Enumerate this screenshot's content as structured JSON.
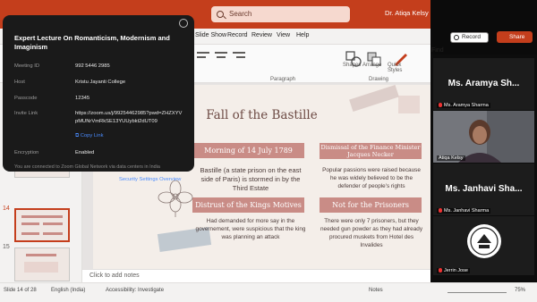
{
  "titlebar": {
    "search_placeholder": "Search",
    "user_name": "Dr. Atiqa Kelsy"
  },
  "menu": [
    "Slide Show",
    "Record",
    "Review",
    "View",
    "Help"
  ],
  "record_label": "Record",
  "share_label": "Share",
  "ribbon": {
    "find_label": "Find",
    "paragraph_label": "Paragraph",
    "drawing_label": "Drawing",
    "shapes_label": "Shapes",
    "arrange_label": "Arrange",
    "quick_styles_label": "Quick Styles"
  },
  "thumbnails": [
    {
      "number": "14",
      "selected": true
    },
    {
      "number": "15",
      "selected": false
    }
  ],
  "slide": {
    "title": "Fall of the Bastille",
    "box1_head": "Morning of 14 July 1789",
    "box1_text": "Bastille (a state prison on the east side of Paris) is stormed in by the Third Estate",
    "box2_head": "Dismissal of the Finance Minister Jacques Necker",
    "box2_text": "Popular passions were raised because he was widely believed to be the defender of people's rights",
    "box3_head": "Distrust of the Kings Motives",
    "box3_text": "Had demanded for more say in the governement, were suspicious that the king was planning an attack",
    "box4_head": "Not for the Prisoners",
    "box4_text": "There were only 7 prisoners, but they needed gun powder as they had already procured muskets from Hotel des Invalides"
  },
  "notes_placeholder": "Click to add notes",
  "status": {
    "slide_count": "Slide 14 of 28",
    "language": "English (India)",
    "accessibility": "Accessibility: Investigate",
    "notes": "Notes",
    "zoom": "75%"
  },
  "zoom_info": {
    "title": "Expert Lecture On Romanticism, Modernism and Imaginism",
    "meeting_id_label": "Meeting ID",
    "meeting_id": "992 5446 2985",
    "host_label": "Host",
    "host": "Kristu Jayanti College",
    "passcode_label": "Passcode",
    "passcode": "12345",
    "invite_label": "Invite Link",
    "invite_line1": "https://zoom.us/j/99254462985?pwd=ZHZXYV",
    "invite_line2": "pMUNrVmRkSE13YUUybkt2dUT09",
    "copy_link": "Copy Link",
    "encryption_label": "Encryption",
    "encryption": "Enabled",
    "network_note": "You are connected to Zoom Global Network via data centers in India",
    "security_link": "Security Settings Overview"
  },
  "participants": [
    {
      "display": "Ms. Aramya Sh...",
      "name": "Ms. Aramya Sharma"
    },
    {
      "display": "",
      "name": "Atiqa Kelsy"
    },
    {
      "display": "Ms. Janhavi Sha...",
      "name": "Ms. Janhavi Sharma"
    },
    {
      "display": "",
      "name": "Jerrin Jose"
    }
  ]
}
